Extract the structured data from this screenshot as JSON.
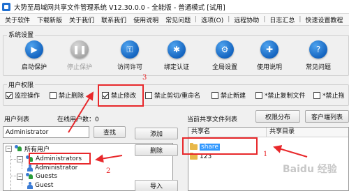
{
  "window": {
    "title": "大势至局域网共享文件管理系统 V12.30.0.0 - 全能版 - 普通模式 [试用]"
  },
  "menubar": {
    "items": [
      "关于软件",
      "下载新版",
      "关于我们",
      "联系我们",
      "使用说明",
      "常见问题",
      "选项(O)",
      "远程协助",
      "日志汇总",
      "快速设置教程"
    ]
  },
  "system_settings": {
    "label": "系统设置",
    "tools": [
      {
        "label": "启动保护",
        "icon": "play-icon",
        "enabled": true
      },
      {
        "label": "停止保护",
        "icon": "pause-icon",
        "enabled": false
      },
      {
        "label": "访问许可",
        "icon": "key-icon",
        "enabled": true
      },
      {
        "label": "绑定认证",
        "icon": "gear-icon",
        "enabled": true
      },
      {
        "label": "全局设置",
        "icon": "settings-icon",
        "enabled": true
      },
      {
        "label": "使用说明",
        "icon": "book-icon",
        "enabled": true
      },
      {
        "label": "常见问题",
        "icon": "question-icon",
        "enabled": true
      }
    ]
  },
  "user_permissions": {
    "label": "用户权限",
    "items": [
      {
        "label": "监控操作",
        "checked": true
      },
      {
        "label": "禁止删除",
        "checked": false
      },
      {
        "label": "禁止修改",
        "checked": true
      },
      {
        "label": "禁止剪切/重命名",
        "checked": false
      },
      {
        "label": "禁止新建",
        "checked": false
      },
      {
        "label": "*禁止复制文件",
        "checked": false
      },
      {
        "label": "*禁止拖",
        "checked": false
      }
    ]
  },
  "user_list": {
    "label": "用户列表",
    "online_label": "在线用户数：0",
    "search_value": "Administrator",
    "search_button": "查找",
    "tree": [
      {
        "label": "所有用户",
        "level": 0,
        "icon": "users-group-icon"
      },
      {
        "label": "Administrators",
        "level": 1,
        "icon": "users-group-icon"
      },
      {
        "label": "Administrator",
        "level": 2,
        "icon": "user-icon"
      },
      {
        "label": "Guests",
        "level": 1,
        "icon": "users-group-icon"
      },
      {
        "label": "Guest",
        "level": 2,
        "icon": "user-icon"
      }
    ]
  },
  "middle_buttons": {
    "add": "添加",
    "delete": "删除",
    "import": "导入"
  },
  "share_list": {
    "label": "当前共享文件列表",
    "permission_button": "权限分布",
    "client_button": "客户端列表",
    "columns": [
      "共享名",
      "共享目录"
    ],
    "rows": [
      {
        "name": "share",
        "dir": "",
        "selected": true
      },
      {
        "name": "123",
        "dir": "",
        "selected": false
      }
    ]
  },
  "annotations": {
    "num1": "1",
    "num2": "2",
    "num3": "3"
  },
  "watermark": "Baidu 经验",
  "colors": {
    "annotation": "#e8282b",
    "tool_blue": "#1565c0",
    "selection": "#3399ff"
  }
}
